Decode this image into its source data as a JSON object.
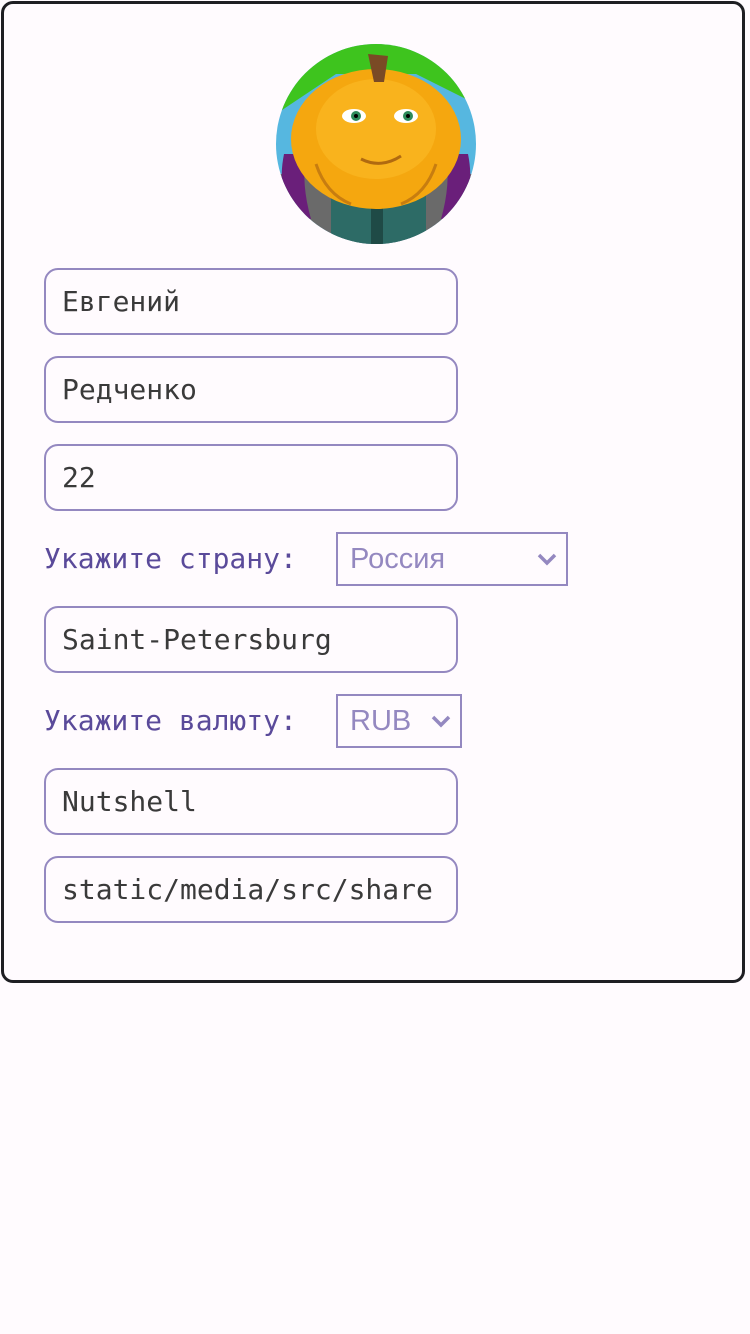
{
  "profile": {
    "avatar_icon": "pumpkin-character-avatar",
    "first_name": "Евгений",
    "last_name": "Редченко",
    "age": "22",
    "country_label": "Укажите страну:",
    "country_value": "Россия",
    "city": "Saint-Petersburg",
    "currency_label": "Укажите валюту:",
    "currency_value": "RUB",
    "nickname": "Nutshell",
    "avatar_path": "static/media/src/share"
  },
  "colors": {
    "border": "#9488c0",
    "label": "#5a4a9a",
    "card_border": "#1e1e22",
    "background": "#fffbfe"
  }
}
